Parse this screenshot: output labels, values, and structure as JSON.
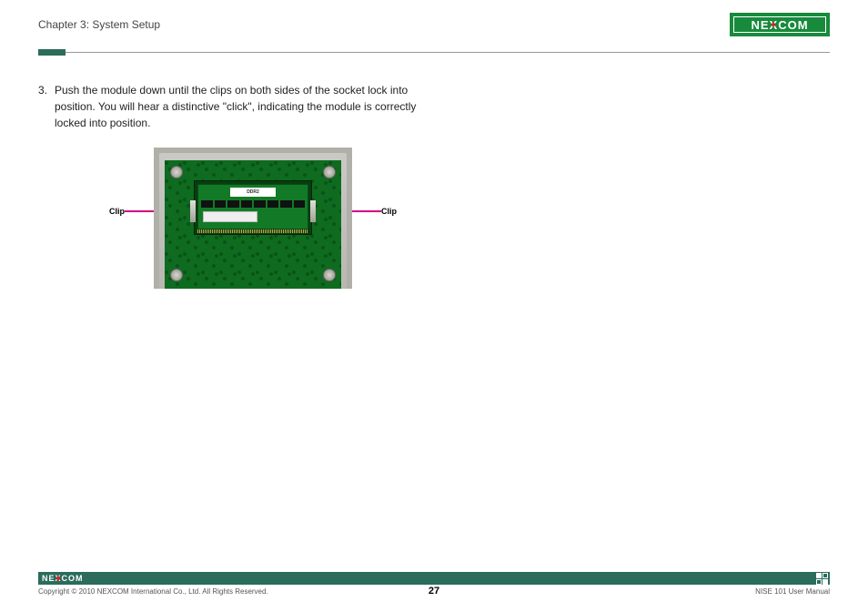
{
  "header": {
    "chapter": "Chapter 3: System Setup",
    "logo_text_pre": "NE",
    "logo_text_x": "X",
    "logo_text_post": "COM"
  },
  "content": {
    "step_number": "3.",
    "step_text": "Push the module down until the clips on both sides of the socket lock into position. You will hear a distinctive \"click\", indicating the module is correctly locked into position."
  },
  "figure": {
    "clip_left": "Clip",
    "clip_right": "Clip",
    "ram_label": "DDR2"
  },
  "footer": {
    "logo_text": "NE COM",
    "copyright": "Copyright © 2010 NEXCOM International Co., Ltd. All Rights Reserved.",
    "page_number": "27",
    "doc_title": "NISE 101 User Manual"
  }
}
